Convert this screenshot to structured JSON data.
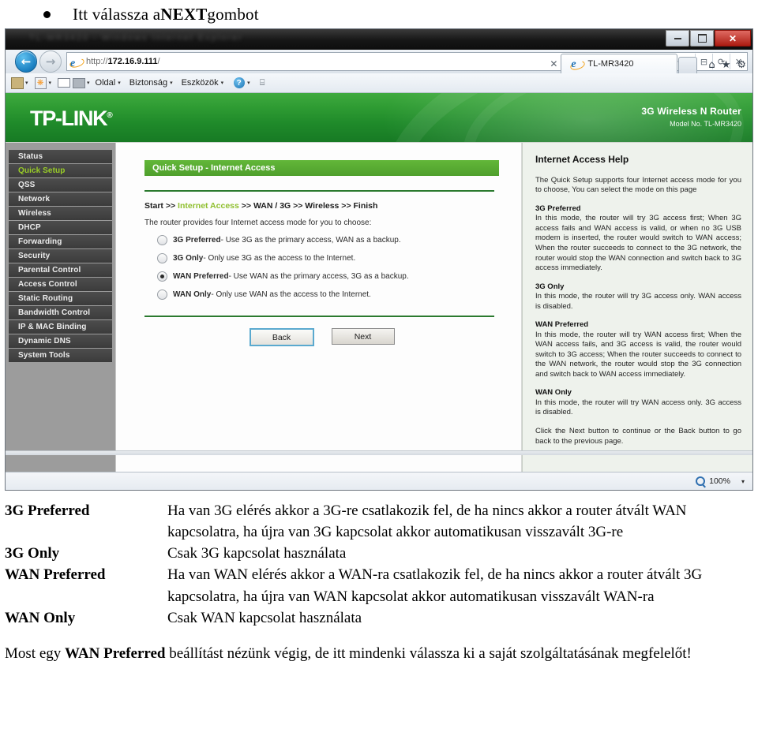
{
  "instruction": {
    "prefix": "Itt válassza a ",
    "emphasis": "NEXT",
    "suffix": " gombot"
  },
  "browser": {
    "window_controls": {
      "minimize": "minimize-icon",
      "maximize": "maximize-icon",
      "close": "✕"
    },
    "address": {
      "scheme": "http://",
      "host": "172.16.9.111",
      "path": "/",
      "full_url": "http://172.16.9.111/"
    },
    "address_tools": {
      "search": "⌕",
      "dropdown": "▾",
      "compat": "⊟",
      "refresh": "⟳",
      "stop": "✕"
    },
    "nav": {
      "back": "←",
      "forward": "→"
    },
    "command_bar": {
      "items": [
        "Oldal",
        "Biztonság",
        "Eszközök"
      ],
      "underlines": [
        "O",
        "B",
        "k"
      ]
    },
    "tab": {
      "title": "TL-MR3420"
    },
    "toolbar_icons": {
      "home": "⌂",
      "favorites": "★",
      "tools": "⚙"
    },
    "status": {
      "zoom": "100%",
      "zoom_caret": "▾"
    }
  },
  "router": {
    "brand": "TP-LINK",
    "brand_mark": "®",
    "product": "3G Wireless N Router",
    "model": "Model No. TL-MR3420",
    "sidebar": {
      "items": [
        {
          "label": "Status",
          "active": false
        },
        {
          "label": "Quick Setup",
          "active": true
        },
        {
          "label": "QSS",
          "active": false
        },
        {
          "label": "Network",
          "active": false
        },
        {
          "label": "Wireless",
          "active": false
        },
        {
          "label": "DHCP",
          "active": false
        },
        {
          "label": "Forwarding",
          "active": false
        },
        {
          "label": "Security",
          "active": false
        },
        {
          "label": "Parental Control",
          "active": false
        },
        {
          "label": "Access Control",
          "active": false
        },
        {
          "label": "Static Routing",
          "active": false
        },
        {
          "label": "Bandwidth Control",
          "active": false
        },
        {
          "label": "IP & MAC Binding",
          "active": false
        },
        {
          "label": "Dynamic DNS",
          "active": false
        },
        {
          "label": "System Tools",
          "active": false
        }
      ]
    },
    "content": {
      "page_title": "Quick Setup - Internet Access",
      "breadcrumb": {
        "start": "Start >> ",
        "current": "Internet Access",
        "rest": " >> WAN / 3G >> Wireless >> Finish"
      },
      "intro": "The router provides four Internet access mode for you to choose:",
      "options": [
        {
          "name": "3G Preferred",
          "desc": " - Use 3G as the primary access, WAN as a backup.",
          "selected": false
        },
        {
          "name": "3G Only",
          "desc": " - Only use 3G as the access to the Internet.",
          "selected": false
        },
        {
          "name": "WAN Preferred",
          "desc": " - Use WAN as the primary access, 3G as a backup.",
          "selected": true
        },
        {
          "name": "WAN Only",
          "desc": " - Only use WAN as the access to the Internet.",
          "selected": false
        }
      ],
      "buttons": {
        "back": "Back",
        "next": "Next"
      }
    },
    "help": {
      "title": "Internet Access Help",
      "lead": "The Quick Setup supports four Internet access mode for you to choose, You can select the mode on this page",
      "sections": [
        {
          "heading": "3G Preferred",
          "body": "In this mode, the router will try 3G access first; When 3G access fails and WAN access is valid, or when no 3G USB modem is inserted, the router would switch to WAN access; When the router succeeds to connect to the 3G network, the router would stop the WAN connection and switch back to 3G access immediately."
        },
        {
          "heading": "3G Only",
          "body": "In this mode, the router will try 3G access only. WAN access is disabled."
        },
        {
          "heading": "WAN Preferred",
          "body": "In this mode, the router will try WAN access first; When the WAN access fails, and 3G access is valid, the router would switch to 3G access; When the router succeeds to connect to the WAN network, the router would stop the 3G connection and switch back to WAN access immediately."
        },
        {
          "heading": "WAN Only",
          "body": "In this mode, the router will try WAN access only. 3G access is disabled."
        }
      ],
      "footer": "Click the Next button to continue or the Back button to go back to the previous page."
    }
  },
  "explanation": {
    "rows": [
      {
        "term": "3G Preferred",
        "text": "Ha van 3G elérés akkor a 3G-re csatlakozik fel, de ha nincs akkor a router átvált WAN kapcsolatra,  ha újra van 3G kapcsolat akkor automatikusan visszavált 3G-re"
      },
      {
        "term": "3G Only",
        "text": "Csak 3G kapcsolat használata"
      },
      {
        "term": "WAN Preferred",
        "text": "Ha van WAN elérés akkor a WAN-ra csatlakozik fel, de ha nincs akkor a router átvált 3G kapcsolatra,  ha újra van WAN kapcsolat akkor automatikusan  visszavált WAN-ra"
      },
      {
        "term": "WAN Only",
        "text": "Csak WAN kapcsolat használata"
      }
    ]
  },
  "closing": {
    "prefix": "Most egy ",
    "emphasis": "WAN Preferred",
    "suffix": " beállítást nézünk végig, de itt mindenki válassza ki a saját szolgáltatásának megfelelőt!"
  },
  "colors": {
    "tplink_green": "#2f9c33",
    "title_green": "#63b739",
    "active_menu_green": "#9ace27",
    "breadcrumb_green": "#8fbf2e",
    "sidebar_bg": "#9c9c9c",
    "menu_item_bg": "#424242",
    "help_bg": "#eef2ec"
  }
}
